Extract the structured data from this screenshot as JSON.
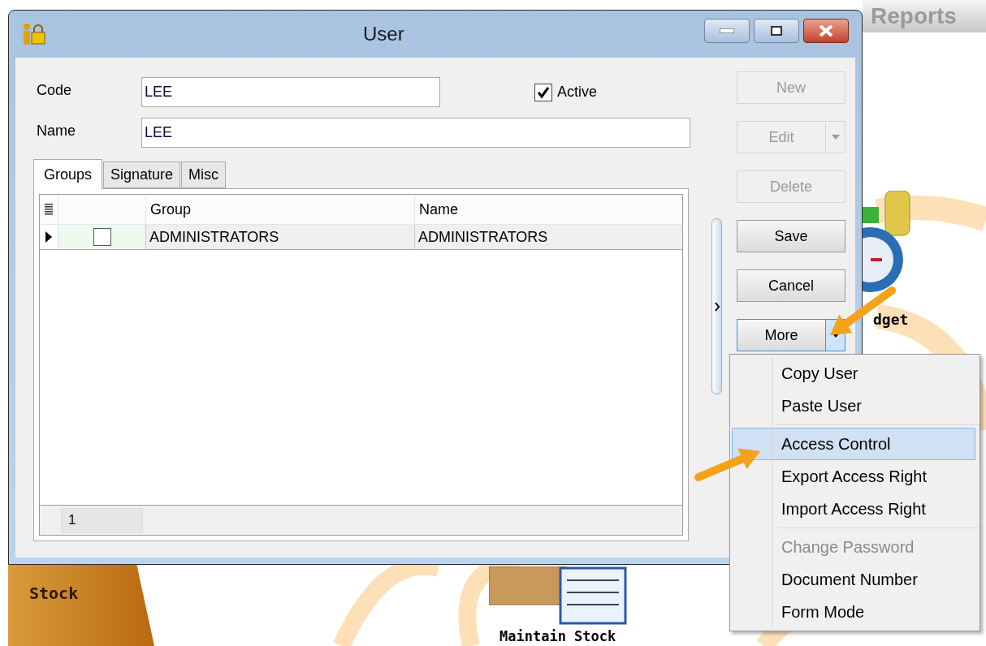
{
  "desktop": {
    "reports_title": "Reports",
    "stock_tab": "Stock",
    "budget_label": "dget",
    "maintain_stock_label": "Maintain Stock"
  },
  "window": {
    "title": "User"
  },
  "fields": [
    {
      "label": "Code",
      "value": "LEE"
    },
    {
      "label": "Name",
      "value": "LEE"
    }
  ],
  "active": {
    "label": "Active",
    "checked": true
  },
  "tabs": [
    {
      "label": "Groups",
      "selected": true
    },
    {
      "label": "Signature",
      "selected": false
    },
    {
      "label": "Misc",
      "selected": false
    }
  ],
  "grid": {
    "columns": [
      "Group",
      "Name"
    ],
    "rows": [
      {
        "current": true,
        "checked": false,
        "group": "ADMINISTRATORS",
        "name": "ADMINISTRATORS"
      }
    ],
    "footer_count": "1"
  },
  "buttons": [
    {
      "label": "New",
      "disabled": true,
      "dropdown": false,
      "pressed": false
    },
    {
      "label": "Edit",
      "disabled": true,
      "dropdown": true,
      "pressed": false
    },
    {
      "label": "Delete",
      "disabled": true,
      "dropdown": false,
      "pressed": false
    },
    {
      "label": "Save",
      "disabled": false,
      "dropdown": false,
      "pressed": false
    },
    {
      "label": "Cancel",
      "disabled": false,
      "dropdown": false,
      "pressed": false
    },
    {
      "label": "More",
      "disabled": false,
      "dropdown": true,
      "pressed": true
    }
  ],
  "menu": {
    "sections": [
      {
        "items": [
          {
            "label": "Copy User",
            "selected": false,
            "disabled": false
          },
          {
            "label": "Paste User",
            "selected": false,
            "disabled": false
          }
        ]
      },
      {
        "items": [
          {
            "label": "Access Control",
            "selected": true,
            "disabled": false
          },
          {
            "label": "Export Access Right",
            "selected": false,
            "disabled": false
          },
          {
            "label": "Import Access Right",
            "selected": false,
            "disabled": false
          }
        ]
      },
      {
        "items": [
          {
            "label": "Change Password",
            "selected": false,
            "disabled": true
          },
          {
            "label": "Document Number",
            "selected": false,
            "disabled": false
          },
          {
            "label": "Form Mode",
            "selected": false,
            "disabled": false
          }
        ]
      }
    ]
  }
}
